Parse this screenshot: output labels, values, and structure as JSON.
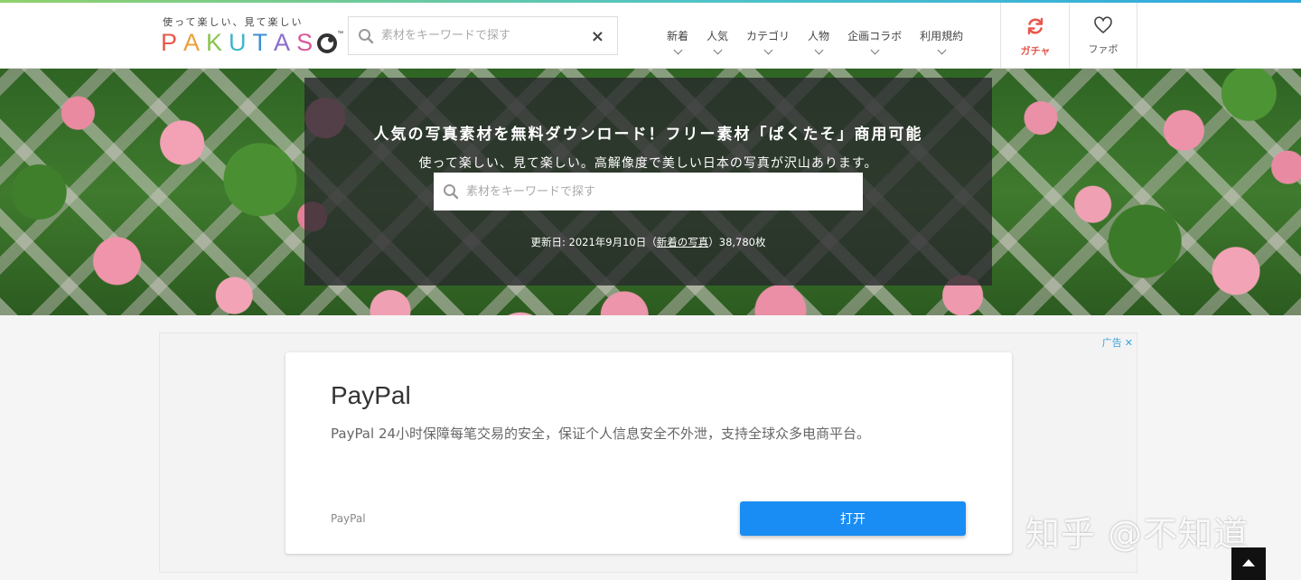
{
  "header": {
    "logo_tagline": "使って楽しい、見て楽しい",
    "logo_letters": [
      "P",
      "A",
      "K",
      "U",
      "T",
      "A",
      "S"
    ],
    "logo_tm": "™",
    "search_placeholder": "素材をキーワードで探す",
    "clear_icon": "×",
    "nav": [
      {
        "label": "新着"
      },
      {
        "label": "人気"
      },
      {
        "label": "カテゴリ"
      },
      {
        "label": "人物"
      },
      {
        "label": "企画コラボ"
      },
      {
        "label": "利用規約"
      }
    ],
    "gacha_label": "ガチャ",
    "fav_label": "ファボ"
  },
  "hero": {
    "title": "人気の写真素材を無料ダウンロード！フリー素材「ぱくたそ」商用可能",
    "subtitle": "使って楽しい、見て楽しい。高解像度で美しい日本の写真が沢山あります。",
    "search_placeholder": "素材をキーワードで探す",
    "update_prefix": "更新日: 2021年9月10日（",
    "update_link": "新着の写真",
    "update_suffix": "）38,780枚"
  },
  "ad": {
    "tag": "广告",
    "close_icon": "✕",
    "title": "PayPal",
    "description": "PayPal 24小时保障每笔交易的安全，保证个人信息安全不外泄，支持全球众多电商平台。",
    "brand": "PayPal",
    "button_label": "打开",
    "button_color": "#1a8df4"
  },
  "watermark": "知乎 @不知道",
  "colors": {
    "gacha": "#e8574b",
    "ad_tag": "#3aa3e0"
  }
}
